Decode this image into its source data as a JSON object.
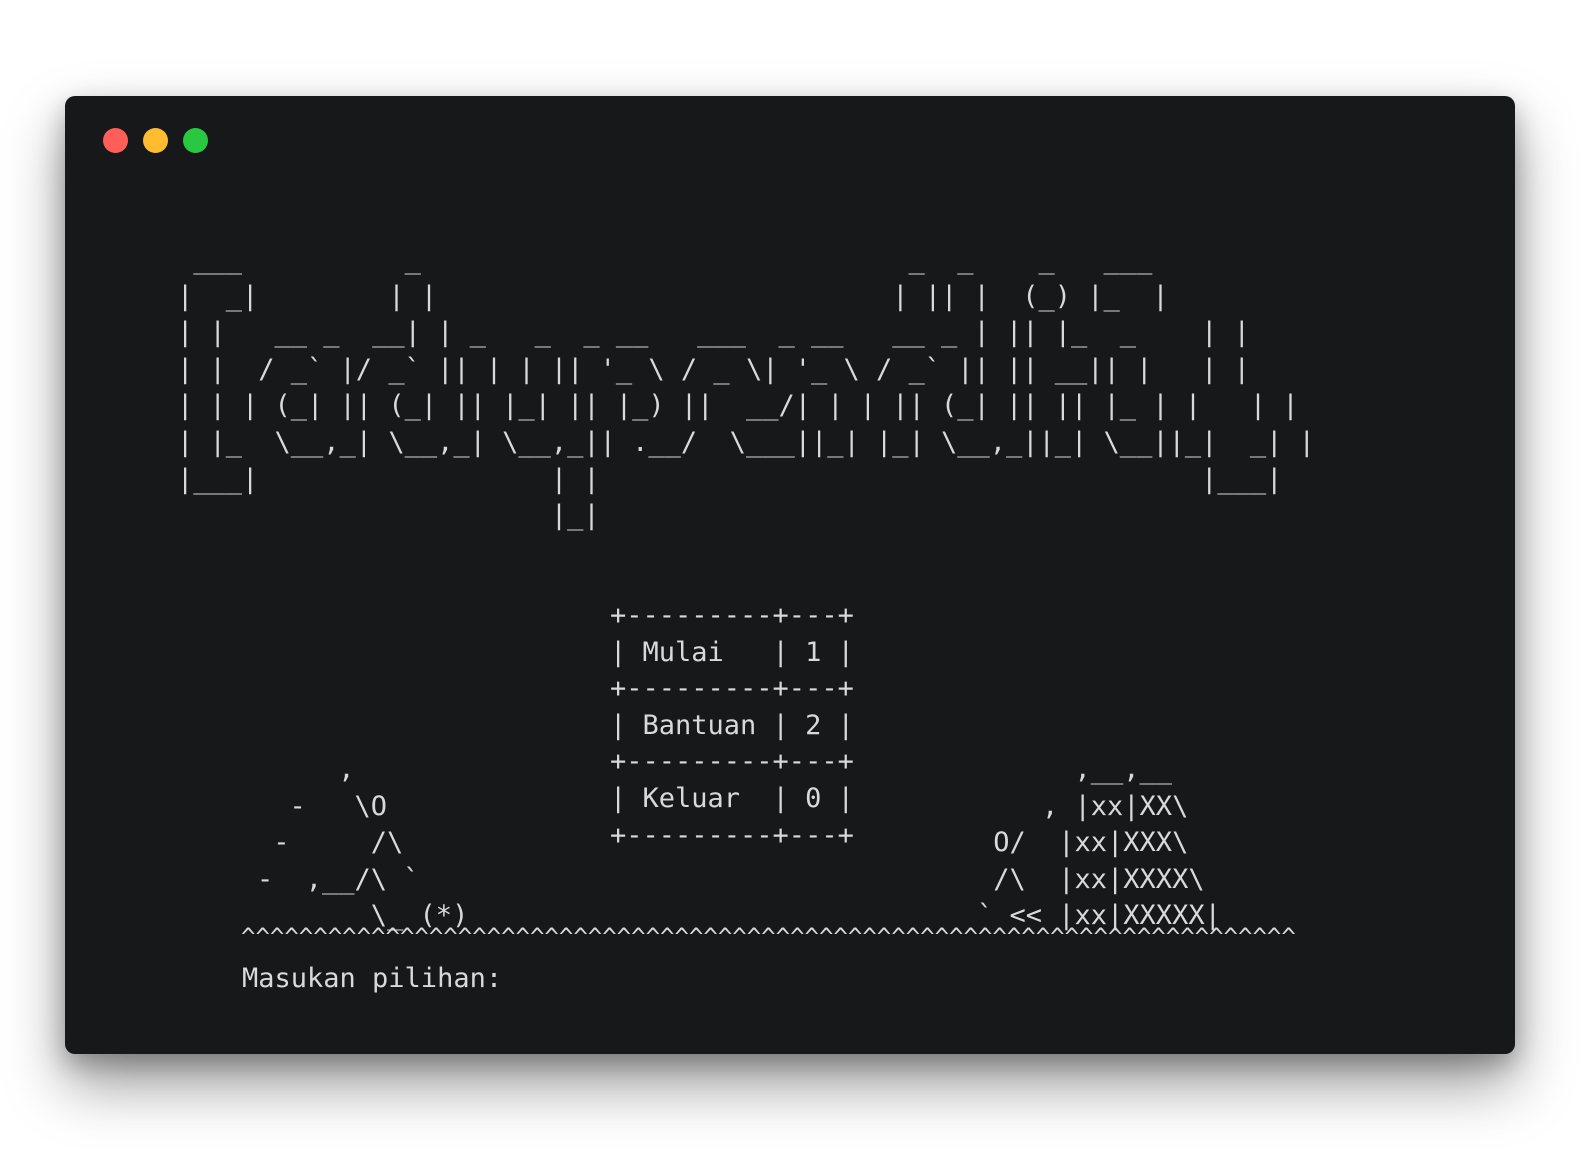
{
  "window": {
    "buttons": {
      "close_color": "#ff5f57",
      "minimize_color": "#febc2e",
      "maximize_color": "#28c840"
    }
  },
  "banner_art": " ___          _                              _  _    _   ___ \n|  _|        | |                            | || |  (_) |_  |\n| |   __ _  __| | _   _  _ __   ___  _ __   __ _ | || |_  _    | |\n| |  / _` |/ _` || | | || '_ \\ / _ \\| '_ \\ / _` || || __|| |   | |\n| | | (_| || (_| || |_| || |_) ||  __/| | | || (_| || || |_ | |   | |\n| |_  \\__,_| \\__,_| \\__,_|| .__/  \\___||_| |_| \\__,_||_| \\__||_|  _| |\n|___|                  | |                                     |___|\n                       |_|",
  "menu": {
    "border": "+---------+---+",
    "options": [
      {
        "label": "| Mulai   | 1 |",
        "key": "1"
      },
      {
        "label": "| Bantuan | 2 |",
        "key": "2"
      },
      {
        "label": "| Keluar  | 0 |",
        "key": "0"
      }
    ]
  },
  "skier_art": "     ,\n  -   \\O\n -     /\\\n-  ,__/\\ `\n       \\_ (*)",
  "chalet_art": "      ,__,__\n    , |xx|XX\\\n O/  |xx|XXX\\\n /\\  |xx|XXXX\\\n` << |xx|XXXXX|",
  "ridge": "^^^^^^^^^^^^^^^^^^^^^^^^^^^^^^^^^^^^^^^^^^^^^^^^^^^^^^^^^^^^^^^^^^^^^^^^^",
  "prompt": {
    "label": "Masukan pilihan:",
    "value": ""
  }
}
